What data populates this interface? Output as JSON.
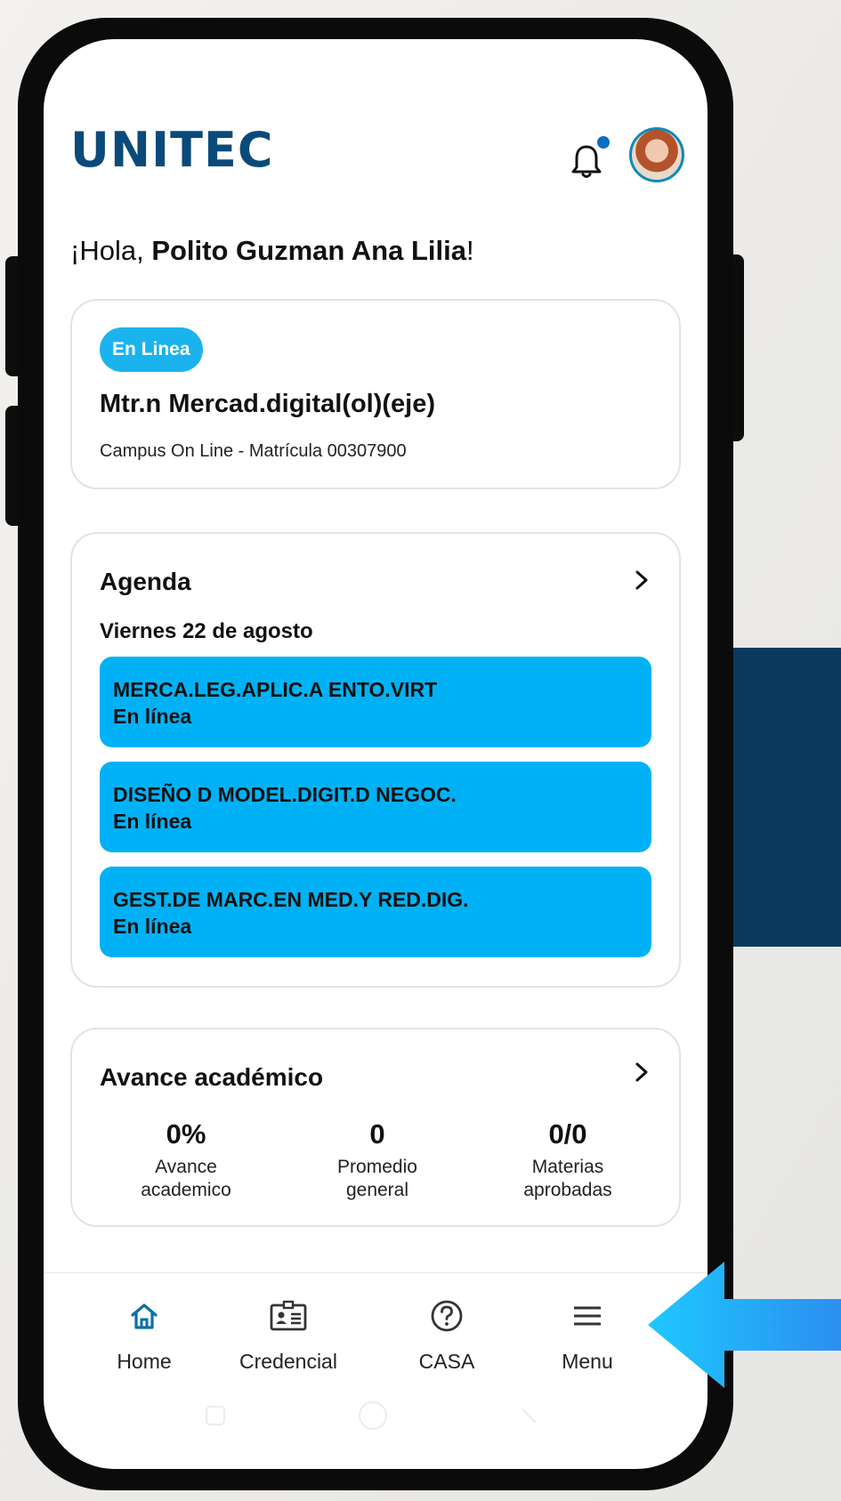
{
  "app": {
    "brand": "UNITEC"
  },
  "greeting": {
    "prefix": "¡Hola, ",
    "name": "Polito Guzman Ana Lilia",
    "suffix": "!"
  },
  "program_card": {
    "badge": "En Linea",
    "program": "Mtr.n Mercad.digital(ol)(eje)",
    "campus": "Campus On Line - Matrícula 00307900"
  },
  "agenda": {
    "title": "Agenda",
    "date": "Viernes 22 de agosto",
    "events": [
      {
        "title": "MERCA.LEG.APLIC.A ENTO.VIRT",
        "mode": "En línea"
      },
      {
        "title": "DISEÑO D MODEL.DIGIT.D NEGOC.",
        "mode": "En línea"
      },
      {
        "title": "GEST.DE MARC.EN MED.Y RED.DIG.",
        "mode": "En línea"
      }
    ]
  },
  "progress": {
    "title": "Avance académico",
    "stats": [
      {
        "value": "0%",
        "label_line1": "Avance",
        "label_line2": "academico"
      },
      {
        "value": "0",
        "label_line1": "Promedio",
        "label_line2": "general"
      },
      {
        "value": "0/0",
        "label_line1": "Materias",
        "label_line2": "aprobadas"
      }
    ]
  },
  "bottom_nav": [
    {
      "label": "Home",
      "icon": "home-icon"
    },
    {
      "label": "Credencial",
      "icon": "id-card-icon"
    },
    {
      "label": "CASA",
      "icon": "help-circle-icon"
    },
    {
      "label": "Menu",
      "icon": "hamburger-menu-icon"
    }
  ],
  "colors": {
    "brand": "#0a4a7a",
    "accent": "#00b2f5",
    "deco_panel": "#093a5e",
    "arrow": "#1ec3ff"
  }
}
